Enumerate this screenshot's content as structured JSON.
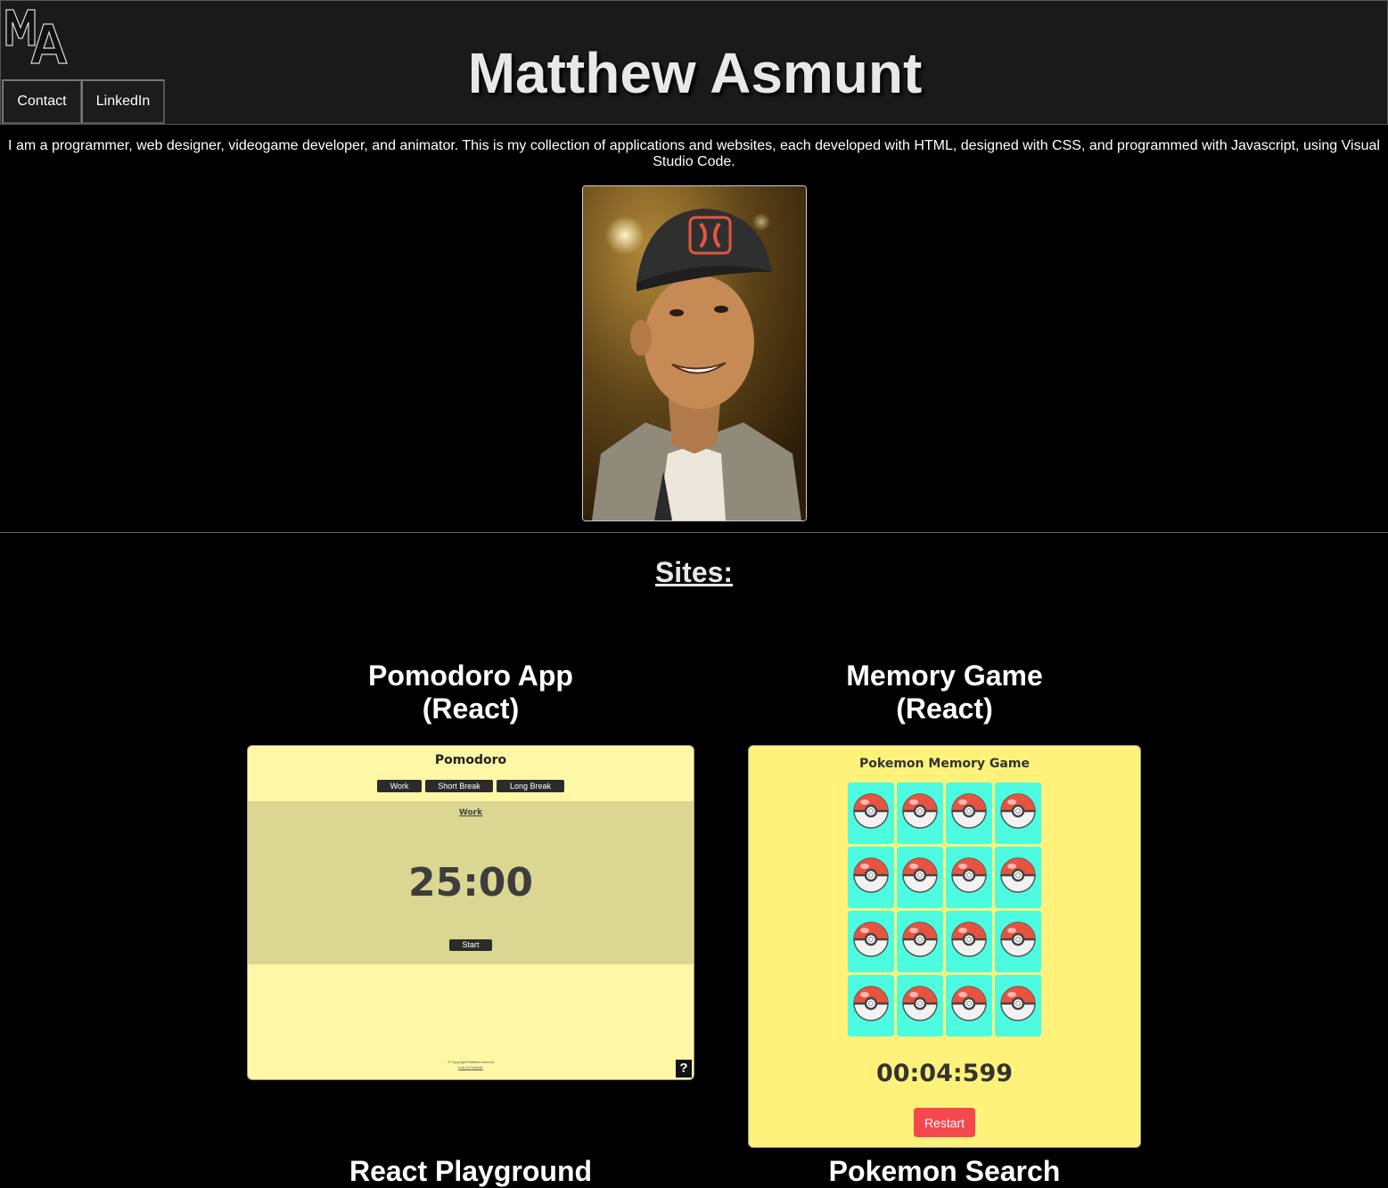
{
  "header": {
    "logo_alt": "MA",
    "title": "Matthew Asmunt",
    "nav": [
      {
        "label": "Contact"
      },
      {
        "label": "LinkedIn"
      }
    ]
  },
  "intro": {
    "text": "I am a programmer, web designer, videogame developer, and animator. This is my collection of applications and websites, each developed with HTML, designed with CSS, and programmed with Javascript, using Visual Studio Code."
  },
  "sites": {
    "heading": "Sites:",
    "projects": [
      {
        "title_line1": "Pomodoro App",
        "title_line2": "(React)",
        "preview": {
          "title": "Pomodoro",
          "tabs": [
            "Work",
            "Short Break",
            "Long Break"
          ],
          "mode": "Work",
          "time": "25:00",
          "start_label": "Start",
          "footer_line1": "© Copyright Matthew Asmunt",
          "footer_line2": "Link to Portfolio",
          "help_label": "?"
        }
      },
      {
        "title_line1": "Memory Game",
        "title_line2": "(React)",
        "preview": {
          "title": "Pokemon Memory Game",
          "card_icon": "pokeball-icon",
          "card_count": 16,
          "timer": "00:04:599",
          "restart_label": "Restart"
        }
      },
      {
        "title_line1": "React Playground"
      },
      {
        "title_line1": "Pokemon Search"
      }
    ]
  },
  "colors": {
    "page_bg": "#000000",
    "header_bg": "#1a1a1a",
    "pomodoro_bg": "#fef7a6",
    "pomodoro_band": "#dbd691",
    "memory_bg": "#fef27a",
    "memory_card": "#4dfce0",
    "restart_button": "#f4474e"
  }
}
